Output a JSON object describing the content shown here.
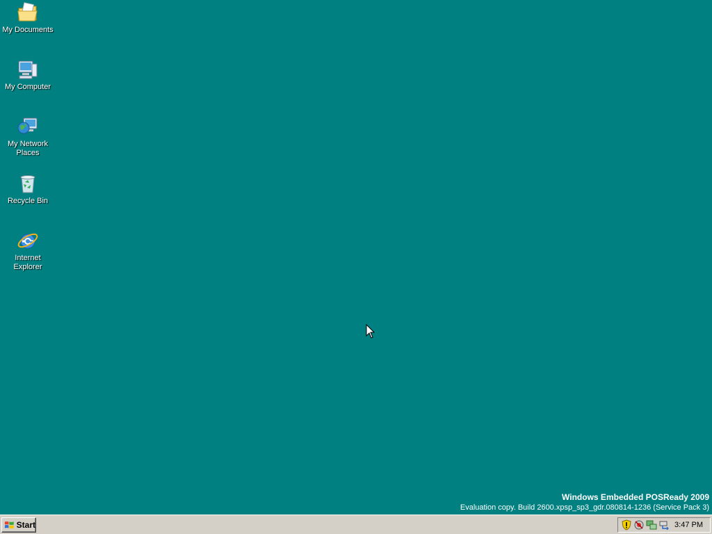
{
  "desktop": {
    "background_color": "#008080",
    "icons": [
      {
        "label": "My Documents",
        "icon": "my-documents-icon"
      },
      {
        "label": "My Computer",
        "icon": "my-computer-icon"
      },
      {
        "label": "My Network Places",
        "icon": "network-places-icon"
      },
      {
        "label": "Recycle Bin",
        "icon": "recycle-bin-icon"
      },
      {
        "label": "Internet Explorer",
        "icon": "internet-explorer-icon"
      }
    ]
  },
  "watermark": {
    "title": "Windows Embedded POSReady 2009",
    "subtitle": "Evaluation copy. Build 2600.xpsp_sp3_gdr.080814-1236 (Service Pack 3)"
  },
  "taskbar": {
    "start_label": "Start",
    "clock": "3:47 PM",
    "tray_icons": [
      "security-shield-icon",
      "antivirus-icon",
      "network-icon",
      "safely-remove-hardware-icon"
    ]
  }
}
